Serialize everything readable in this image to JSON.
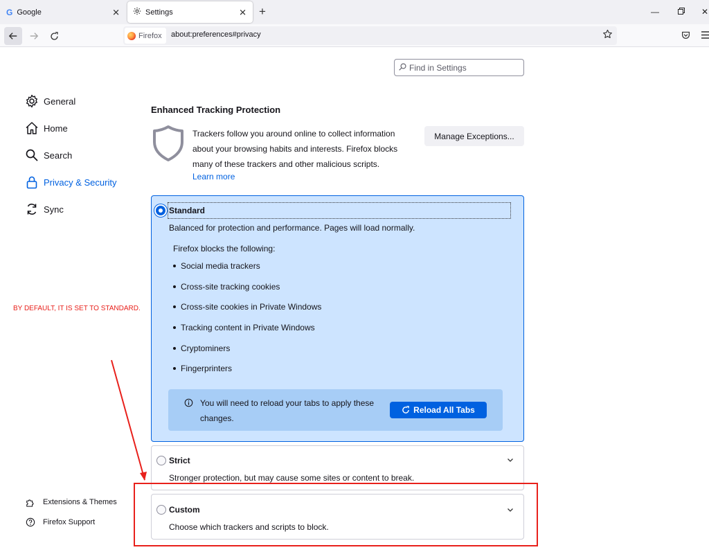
{
  "tabs": [
    {
      "label": "Google",
      "icon": "google-g-icon"
    },
    {
      "label": "Settings",
      "icon": "gear-icon"
    }
  ],
  "navbar": {
    "identity_label": "Firefox",
    "url": "about:preferences#privacy"
  },
  "sidebar": {
    "items": [
      {
        "label": "General",
        "icon": "gear-icon"
      },
      {
        "label": "Home",
        "icon": "home-icon"
      },
      {
        "label": "Search",
        "icon": "search-icon"
      },
      {
        "label": "Privacy & Security",
        "icon": "lock-icon",
        "selected": true
      },
      {
        "label": "Sync",
        "icon": "sync-icon"
      }
    ],
    "footer": [
      {
        "label": "Extensions & Themes",
        "icon": "puzzle-icon"
      },
      {
        "label": "Firefox Support",
        "icon": "help-icon"
      }
    ]
  },
  "search": {
    "placeholder": "Find in Settings"
  },
  "etp": {
    "title": "Enhanced Tracking Protection",
    "description": "Trackers follow you around online to collect information about your browsing habits and interests. Firefox blocks many of these trackers and other malicious scripts.",
    "learn_more": "Learn more",
    "manage_button": "Manage Exceptions..."
  },
  "standard": {
    "label": "Standard",
    "description": "Balanced for protection and performance. Pages will load normally.",
    "blocks_title": "Firefox blocks the following:",
    "blocks": [
      "Social media trackers",
      "Cross-site tracking cookies",
      "Cross-site cookies in Private Windows",
      "Tracking content in Private Windows",
      "Cryptominers",
      "Fingerprinters"
    ],
    "reload_notice": "You will need to reload your tabs to apply these changes.",
    "reload_button": "Reload All Tabs"
  },
  "strict": {
    "label": "Strict",
    "description": "Stronger protection, but may cause some sites or content to break."
  },
  "custom": {
    "label": "Custom",
    "description": "Choose which trackers and scripts to block."
  },
  "annotation": {
    "text": "BY DEFAULT, IT IS SET TO STANDARD.",
    "color": "#e8201b"
  },
  "colors": {
    "accent": "#0061e0",
    "selected_card_bg": "#cde4ff",
    "notice_bg": "#a7cdf6"
  }
}
